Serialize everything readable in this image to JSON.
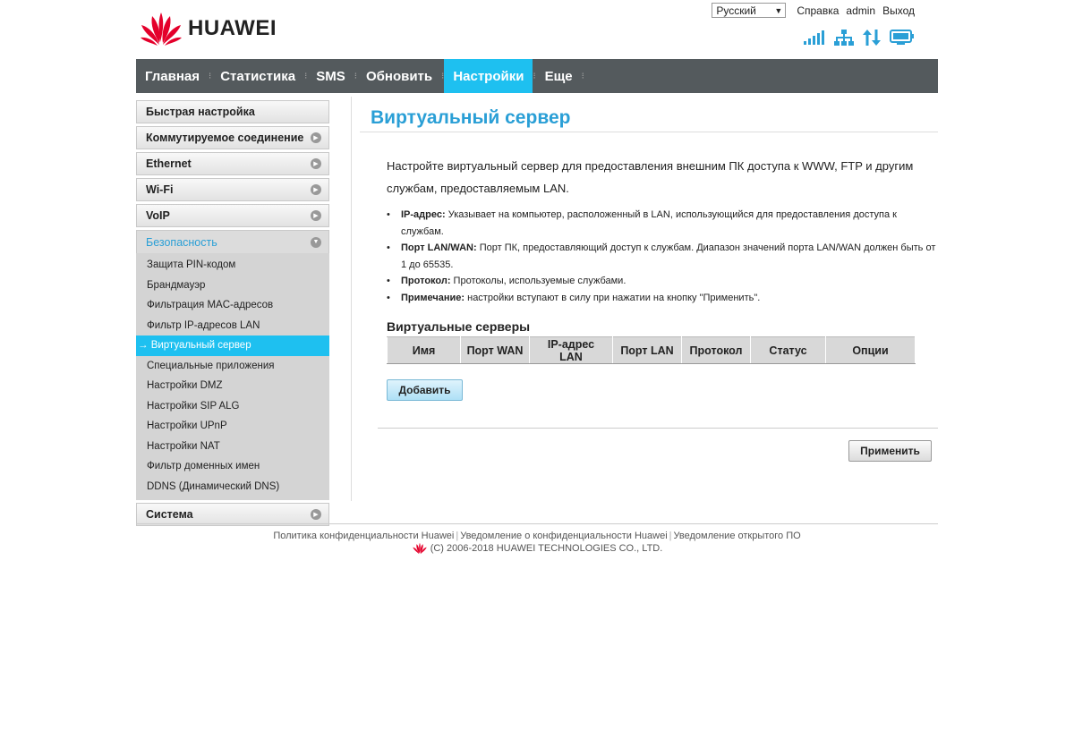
{
  "brand": {
    "name": "HUAWEI",
    "colors": {
      "accent": "#1ec0f0",
      "title": "#2a9fd6",
      "nav_bg": "#545a5d",
      "logo_red": "#e4002b"
    }
  },
  "topbar": {
    "language": "Русский",
    "help": "Справка",
    "user": "admin",
    "logout": "Выход"
  },
  "status_icons": [
    "signal-icon",
    "network-icon",
    "data-transfer-icon",
    "monitor-icon"
  ],
  "nav": {
    "items": [
      {
        "label": "Главная"
      },
      {
        "label": "Статистика"
      },
      {
        "label": "SMS"
      },
      {
        "label": "Обновить"
      },
      {
        "label": "Настройки"
      },
      {
        "label": "Еще"
      }
    ],
    "active": "Настройки"
  },
  "sidebar": {
    "groups": [
      {
        "label": "Быстрая настройка"
      },
      {
        "label": "Коммутируемое соединение"
      },
      {
        "label": "Ethernet"
      },
      {
        "label": "Wi-Fi"
      },
      {
        "label": "VoIP"
      },
      {
        "label": "Безопасность"
      },
      {
        "label": "Система"
      }
    ],
    "security_items": [
      {
        "label": "Защита PIN-кодом"
      },
      {
        "label": "Брандмауэр"
      },
      {
        "label": "Фильтрация MAC-адресов"
      },
      {
        "label": "Фильтр IP-адресов LAN"
      },
      {
        "label": "→ Виртуальный сервер"
      },
      {
        "label": "Специальные приложения"
      },
      {
        "label": "Настройки DMZ"
      },
      {
        "label": "Настройки SIP ALG"
      },
      {
        "label": "Настройки UPnP"
      },
      {
        "label": "Настройки NAT"
      },
      {
        "label": "Фильтр доменных имен"
      },
      {
        "label": "DDNS (Динамический DNS)"
      }
    ]
  },
  "main": {
    "title": "Виртуальный сервер",
    "intro": "Настройте виртуальный сервер для предоставления внешним ПК доступа к WWW, FTP и другим службам, предоставляемым LAN.",
    "bullets": [
      {
        "term": "IP-адрес:",
        "text": " Указывает на компьютер, расположенный в LAN, использующийся для предоставления доступа к службам."
      },
      {
        "term": "Порт LAN/WAN:",
        "text": " Порт ПК, предоставляющий доступ к службам. Диапазон значений порта LAN/WAN должен быть от 1 до 65535."
      },
      {
        "term": "Протокол:",
        "text": " Протоколы, используемые службами."
      },
      {
        "term": "Примечание:",
        "text": " настройки вступают в силу при нажатии на кнопку \"Применить\"."
      }
    ],
    "table_title": "Виртуальные серверы",
    "columns": [
      "Имя",
      "Порт WAN",
      "IP-адрес LAN",
      "Порт LAN",
      "Протокол",
      "Статус",
      "Опции"
    ],
    "add_button": "Добавить",
    "apply_button": "Применить"
  },
  "footer": {
    "links": [
      "Политика конфиденциальности Huawei",
      "Уведомление о конфиденциальности Huawei",
      "Уведомление открытого ПО"
    ],
    "copyright": "(C) 2006-2018 HUAWEI TECHNOLOGIES CO., LTD."
  }
}
